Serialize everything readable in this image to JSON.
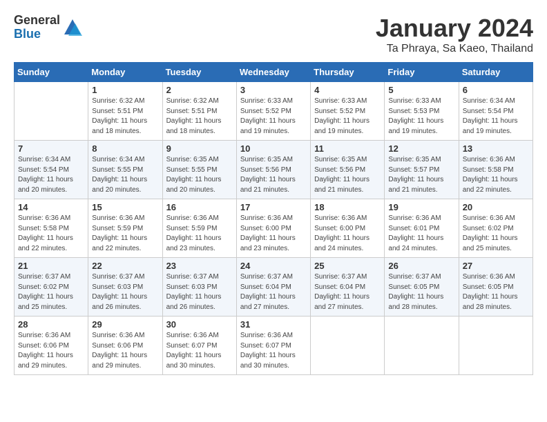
{
  "logo": {
    "general": "General",
    "blue": "Blue"
  },
  "title": "January 2024",
  "subtitle": "Ta Phraya, Sa Kaeo, Thailand",
  "days_of_week": [
    "Sunday",
    "Monday",
    "Tuesday",
    "Wednesday",
    "Thursday",
    "Friday",
    "Saturday"
  ],
  "weeks": [
    [
      {
        "day": "",
        "info": ""
      },
      {
        "day": "1",
        "info": "Sunrise: 6:32 AM\nSunset: 5:51 PM\nDaylight: 11 hours\nand 18 minutes."
      },
      {
        "day": "2",
        "info": "Sunrise: 6:32 AM\nSunset: 5:51 PM\nDaylight: 11 hours\nand 18 minutes."
      },
      {
        "day": "3",
        "info": "Sunrise: 6:33 AM\nSunset: 5:52 PM\nDaylight: 11 hours\nand 19 minutes."
      },
      {
        "day": "4",
        "info": "Sunrise: 6:33 AM\nSunset: 5:52 PM\nDaylight: 11 hours\nand 19 minutes."
      },
      {
        "day": "5",
        "info": "Sunrise: 6:33 AM\nSunset: 5:53 PM\nDaylight: 11 hours\nand 19 minutes."
      },
      {
        "day": "6",
        "info": "Sunrise: 6:34 AM\nSunset: 5:54 PM\nDaylight: 11 hours\nand 19 minutes."
      }
    ],
    [
      {
        "day": "7",
        "info": "Sunrise: 6:34 AM\nSunset: 5:54 PM\nDaylight: 11 hours\nand 20 minutes."
      },
      {
        "day": "8",
        "info": "Sunrise: 6:34 AM\nSunset: 5:55 PM\nDaylight: 11 hours\nand 20 minutes."
      },
      {
        "day": "9",
        "info": "Sunrise: 6:35 AM\nSunset: 5:55 PM\nDaylight: 11 hours\nand 20 minutes."
      },
      {
        "day": "10",
        "info": "Sunrise: 6:35 AM\nSunset: 5:56 PM\nDaylight: 11 hours\nand 21 minutes."
      },
      {
        "day": "11",
        "info": "Sunrise: 6:35 AM\nSunset: 5:56 PM\nDaylight: 11 hours\nand 21 minutes."
      },
      {
        "day": "12",
        "info": "Sunrise: 6:35 AM\nSunset: 5:57 PM\nDaylight: 11 hours\nand 21 minutes."
      },
      {
        "day": "13",
        "info": "Sunrise: 6:36 AM\nSunset: 5:58 PM\nDaylight: 11 hours\nand 22 minutes."
      }
    ],
    [
      {
        "day": "14",
        "info": "Sunrise: 6:36 AM\nSunset: 5:58 PM\nDaylight: 11 hours\nand 22 minutes."
      },
      {
        "day": "15",
        "info": "Sunrise: 6:36 AM\nSunset: 5:59 PM\nDaylight: 11 hours\nand 22 minutes."
      },
      {
        "day": "16",
        "info": "Sunrise: 6:36 AM\nSunset: 5:59 PM\nDaylight: 11 hours\nand 23 minutes."
      },
      {
        "day": "17",
        "info": "Sunrise: 6:36 AM\nSunset: 6:00 PM\nDaylight: 11 hours\nand 23 minutes."
      },
      {
        "day": "18",
        "info": "Sunrise: 6:36 AM\nSunset: 6:00 PM\nDaylight: 11 hours\nand 24 minutes."
      },
      {
        "day": "19",
        "info": "Sunrise: 6:36 AM\nSunset: 6:01 PM\nDaylight: 11 hours\nand 24 minutes."
      },
      {
        "day": "20",
        "info": "Sunrise: 6:36 AM\nSunset: 6:02 PM\nDaylight: 11 hours\nand 25 minutes."
      }
    ],
    [
      {
        "day": "21",
        "info": "Sunrise: 6:37 AM\nSunset: 6:02 PM\nDaylight: 11 hours\nand 25 minutes."
      },
      {
        "day": "22",
        "info": "Sunrise: 6:37 AM\nSunset: 6:03 PM\nDaylight: 11 hours\nand 26 minutes."
      },
      {
        "day": "23",
        "info": "Sunrise: 6:37 AM\nSunset: 6:03 PM\nDaylight: 11 hours\nand 26 minutes."
      },
      {
        "day": "24",
        "info": "Sunrise: 6:37 AM\nSunset: 6:04 PM\nDaylight: 11 hours\nand 27 minutes."
      },
      {
        "day": "25",
        "info": "Sunrise: 6:37 AM\nSunset: 6:04 PM\nDaylight: 11 hours\nand 27 minutes."
      },
      {
        "day": "26",
        "info": "Sunrise: 6:37 AM\nSunset: 6:05 PM\nDaylight: 11 hours\nand 28 minutes."
      },
      {
        "day": "27",
        "info": "Sunrise: 6:36 AM\nSunset: 6:05 PM\nDaylight: 11 hours\nand 28 minutes."
      }
    ],
    [
      {
        "day": "28",
        "info": "Sunrise: 6:36 AM\nSunset: 6:06 PM\nDaylight: 11 hours\nand 29 minutes."
      },
      {
        "day": "29",
        "info": "Sunrise: 6:36 AM\nSunset: 6:06 PM\nDaylight: 11 hours\nand 29 minutes."
      },
      {
        "day": "30",
        "info": "Sunrise: 6:36 AM\nSunset: 6:07 PM\nDaylight: 11 hours\nand 30 minutes."
      },
      {
        "day": "31",
        "info": "Sunrise: 6:36 AM\nSunset: 6:07 PM\nDaylight: 11 hours\nand 30 minutes."
      },
      {
        "day": "",
        "info": ""
      },
      {
        "day": "",
        "info": ""
      },
      {
        "day": "",
        "info": ""
      }
    ]
  ]
}
